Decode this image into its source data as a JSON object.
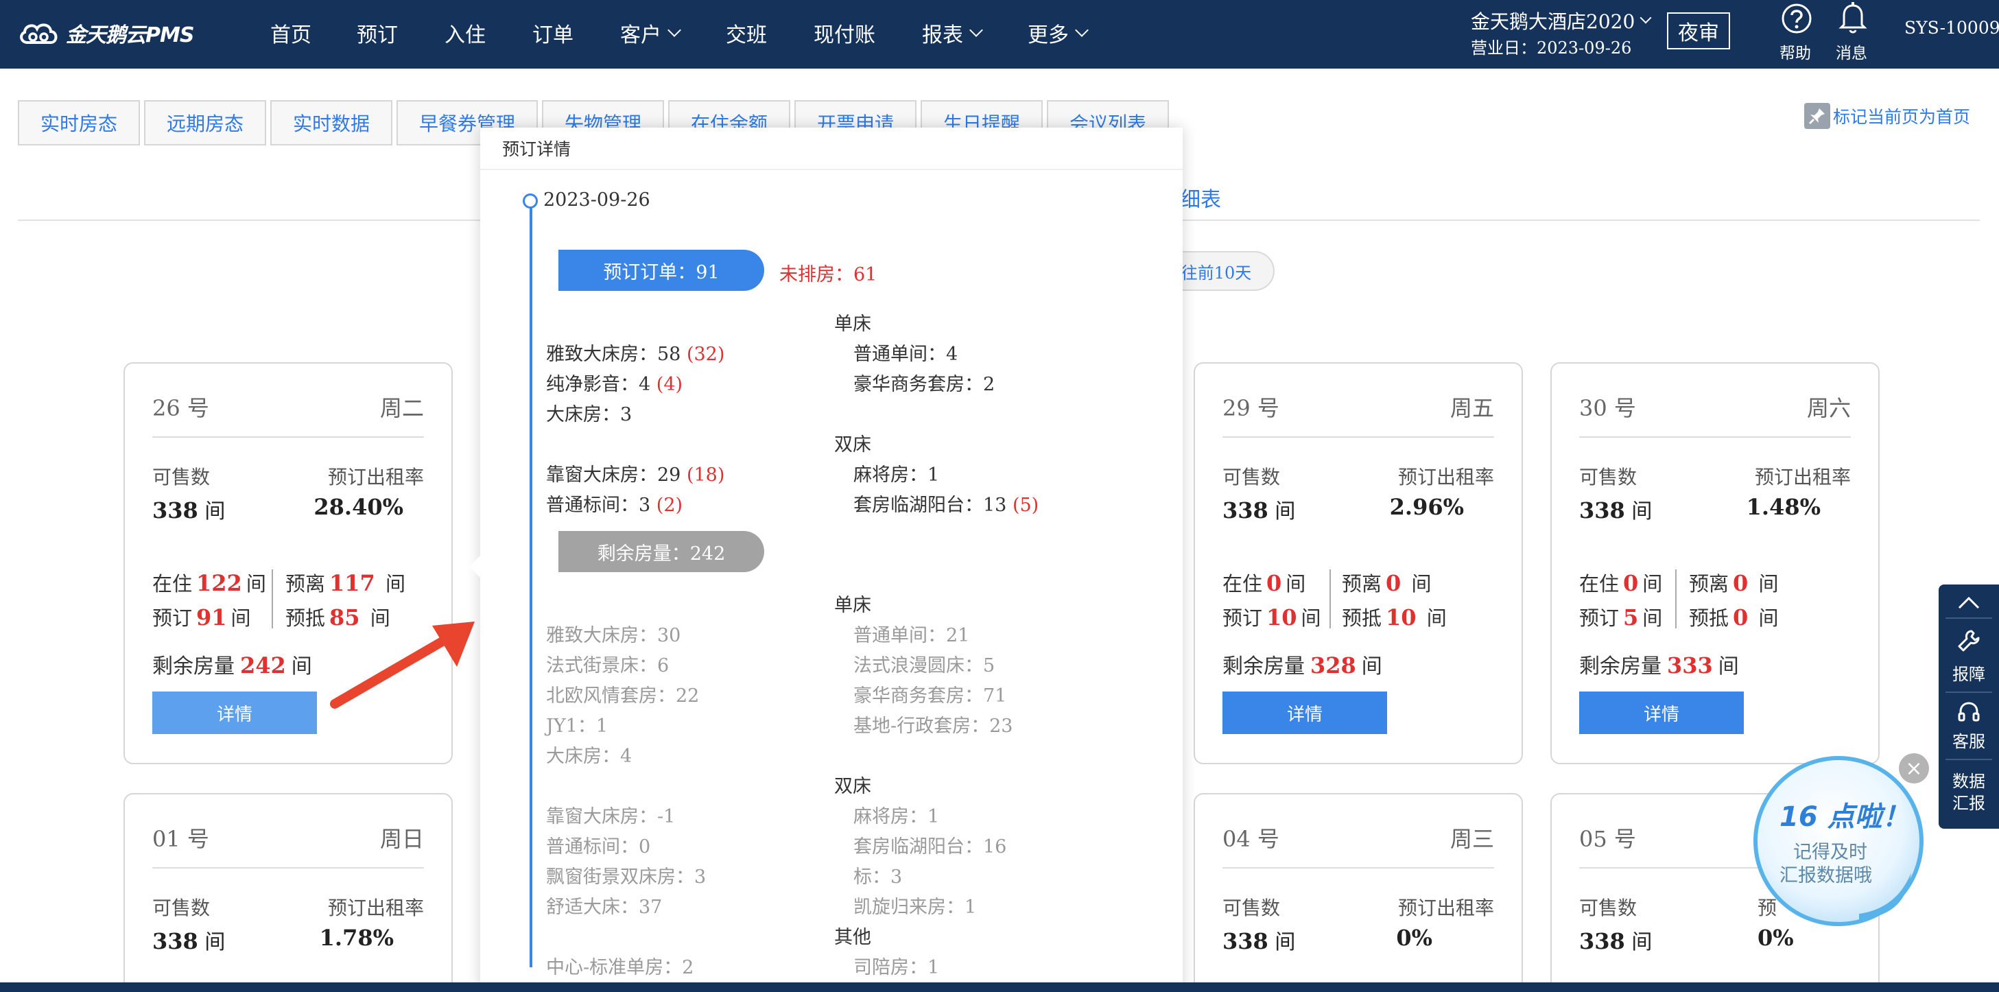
{
  "app": {
    "logo_text": "金天鹅云PMS"
  },
  "nav": [
    {
      "label": "首页",
      "dropdown": false
    },
    {
      "label": "预订",
      "dropdown": false
    },
    {
      "label": "入住",
      "dropdown": false
    },
    {
      "label": "订单",
      "dropdown": false
    },
    {
      "label": "客户",
      "dropdown": true
    },
    {
      "label": "交班",
      "dropdown": false
    },
    {
      "label": "现付账",
      "dropdown": false
    },
    {
      "label": "报表",
      "dropdown": true
    },
    {
      "label": "更多",
      "dropdown": true
    }
  ],
  "header": {
    "hotel": "金天鹅大酒店2020",
    "business_day": "营业日：2023-09-26",
    "night_audit": "夜审",
    "help": "帮助",
    "messages": "消息",
    "user": "SYS-10009"
  },
  "tabs": [
    "实时房态",
    "远期房态",
    "实时数据",
    "早餐券管理",
    "失物管理",
    "在住余额",
    "开票申请",
    "生日提醒",
    "会议列表"
  ],
  "pin_home": "标记当前页为首页",
  "subtitle_partial": "细表",
  "prev_button_partial": "往前10天",
  "cards": [
    {
      "day": "26 号",
      "weekday": "周二",
      "sellable_label": "可售数",
      "sellable": "338",
      "unit": "间",
      "rate_label": "预订出租率",
      "rate": "28.40%",
      "in_house_label": "在住",
      "in_house": "122",
      "departing_label": "预离",
      "departing": "117",
      "booked_label": "预订",
      "booked": "91",
      "arriving_label": "预抵",
      "arriving": "85",
      "remain_label": "剩余房量",
      "remain": "242",
      "detail": "详情",
      "detail_active": true
    },
    {
      "day": "29 号",
      "weekday": "周五",
      "sellable_label": "可售数",
      "sellable": "338",
      "unit": "间",
      "rate_label": "预订出租率",
      "rate": "2.96%",
      "in_house_label": "在住",
      "in_house": "0",
      "departing_label": "预离",
      "departing": "0",
      "booked_label": "预订",
      "booked": "10",
      "arriving_label": "预抵",
      "arriving": "10",
      "remain_label": "剩余房量",
      "remain": "328",
      "detail": "详情",
      "detail_active": false
    },
    {
      "day": "30 号",
      "weekday": "周六",
      "sellable_label": "可售数",
      "sellable": "338",
      "unit": "间",
      "rate_label": "预订出租率",
      "rate": "1.48%",
      "in_house_label": "在住",
      "in_house": "0",
      "departing_label": "预离",
      "departing": "0",
      "booked_label": "预订",
      "booked": "5",
      "arriving_label": "预抵",
      "arriving": "0",
      "remain_label": "剩余房量",
      "remain": "333",
      "detail": "详情",
      "detail_active": false
    }
  ],
  "cards_row2": [
    {
      "day": "01 号",
      "weekday": "周日",
      "sellable_label": "可售数",
      "sellable": "338",
      "unit": "间",
      "rate_label": "预订出租率",
      "rate": "1.78%"
    },
    {
      "day": "04 号",
      "weekday": "周三",
      "sellable_label": "可售数",
      "sellable": "338",
      "unit": "间",
      "rate_label": "预订出租率",
      "rate": "0%"
    },
    {
      "day": "05 号",
      "weekday": "",
      "sellable_label": "可售数",
      "sellable": "338",
      "unit": "间",
      "rate_label": "预",
      "rate": "0%"
    }
  ],
  "popover": {
    "title": "预订详情",
    "date": "2023-09-26",
    "booked_pill": "预订订单：91",
    "unassigned": "未排房：61",
    "remain_pill": "剩余房量：242",
    "booked_left": [
      {
        "name": "雅致大床房：58",
        "extra": "(32)"
      },
      {
        "name": "纯净影音：4",
        "extra": "(4)"
      },
      {
        "name": "大床房：3",
        "extra": ""
      },
      {
        "name": "靠窗大床房：29",
        "extra": "(18)"
      },
      {
        "name": "普通标间：3",
        "extra": "(2)"
      }
    ],
    "booked_right": {
      "single_title": "单床",
      "single": [
        "普通单间：4",
        "豪华商务套房：2"
      ],
      "double_title": "双床",
      "double": [
        {
          "name": "麻将房：1",
          "extra": ""
        },
        {
          "name": "套房临湖阳台：13",
          "extra": "(5)"
        }
      ]
    },
    "remain_left": [
      "雅致大床房：30",
      "法式街景床：6",
      "北欧风情套房：22",
      "JY1：1",
      "大床房：4",
      "靠窗大床房：-1",
      "普通标间：0",
      "飘窗街景双床房：3",
      "舒适大床：37",
      "中心-标准单房：2"
    ],
    "remain_right": {
      "single_title": "单床",
      "single": [
        "普通单间：21",
        "法式浪漫圆床：5",
        "豪华商务套房：71",
        "基地-行政套房：23"
      ],
      "double_title": "双床",
      "double": [
        "麻将房：1",
        "套房临湖阳台：16",
        "标：3",
        "凯旋归来房：1"
      ],
      "other_title": "其他",
      "other": [
        "司陪房：1"
      ]
    }
  },
  "sidebar": {
    "report": "报障",
    "service": "客服",
    "data1": "数据",
    "data2": "汇报"
  },
  "bubble": {
    "line1": "16 点啦！",
    "line2": "记得及时",
    "line3": "汇报数据哦"
  },
  "colors": {
    "navy": "#14325a",
    "accent": "#2f7ae5",
    "red": "#e03030",
    "button": "#3a86e8",
    "button_light": "#5da1ee",
    "grey_pill": "#a3a3a3"
  }
}
